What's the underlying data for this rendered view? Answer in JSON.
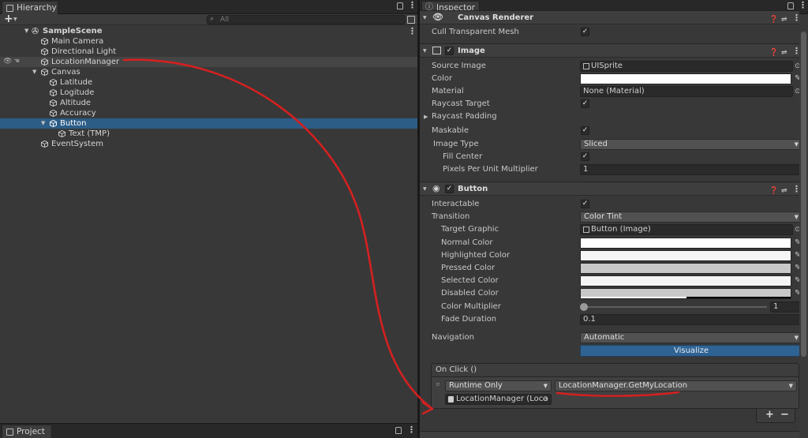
{
  "hierarchy": {
    "tab_label": "Hierarchy",
    "add_label": "+",
    "search_placeholder": "All",
    "rows": [
      {
        "label": "SampleScene"
      },
      {
        "label": "Main Camera"
      },
      {
        "label": "Directional Light"
      },
      {
        "label": "LocationManager"
      },
      {
        "label": "Canvas"
      },
      {
        "label": "Latitude"
      },
      {
        "label": "Logitude"
      },
      {
        "label": "Altitude"
      },
      {
        "label": "Accuracy"
      },
      {
        "label": "Button"
      },
      {
        "label": "Text (TMP)"
      },
      {
        "label": "EventSystem"
      }
    ]
  },
  "project": {
    "tab_label": "Project"
  },
  "inspector": {
    "tab_label": "Inspector",
    "canvas_renderer": {
      "title": "Canvas Renderer",
      "cull_label": "Cull Transparent Mesh",
      "cull_checked": true
    },
    "image": {
      "title": "Image",
      "source_image_label": "Source Image",
      "source_image_value": "UISprite",
      "color_label": "Color",
      "color_value": "#ffffff",
      "material_label": "Material",
      "material_value": "None (Material)",
      "raycast_target_label": "Raycast Target",
      "raycast_target_checked": true,
      "raycast_padding_label": "Raycast Padding",
      "maskable_label": "Maskable",
      "maskable_checked": true,
      "image_type_label": "Image Type",
      "image_type_value": "Sliced",
      "fill_center_label": "Fill Center",
      "fill_center_checked": true,
      "ppu_label": "Pixels Per Unit Multiplier",
      "ppu_value": "1"
    },
    "button": {
      "title": "Button",
      "interactable_label": "Interactable",
      "interactable_checked": true,
      "transition_label": "Transition",
      "transition_value": "Color Tint",
      "target_graphic_label": "Target Graphic",
      "target_graphic_value": "Button (Image)",
      "normal_color_label": "Normal Color",
      "normal_color_value": "#ffffff",
      "highlighted_color_label": "Highlighted Color",
      "highlighted_color_value": "#f5f5f5",
      "pressed_color_label": "Pressed Color",
      "pressed_color_value": "#c8c8c8",
      "selected_color_label": "Selected Color",
      "selected_color_value": "#f5f5f5",
      "disabled_color_label": "Disabled Color",
      "disabled_color_value": "#c8c8c8",
      "color_multiplier_label": "Color Multiplier",
      "color_multiplier_value": "1",
      "fade_duration_label": "Fade Duration",
      "fade_duration_value": "0.1",
      "navigation_label": "Navigation",
      "navigation_value": "Automatic",
      "visualize_label": "Visualize",
      "on_click_label": "On Click ()",
      "runtime_value": "Runtime Only",
      "function_value": "LocationManager.GetMyLocation",
      "object_value": "LocationManager (Loca"
    }
  },
  "colors": {
    "selection": "#2c5d87",
    "annotation": "#d42020",
    "visualize": "#2f6393"
  },
  "icons": [
    "unity-scene-icon",
    "gameobject-cube-icon",
    "eye-icon",
    "lock-icon",
    "kebab-menu-icon",
    "help-icon",
    "preset-icon",
    "eyedropper-icon",
    "object-picker-icon",
    "image-component-icon",
    "button-component-icon"
  ]
}
